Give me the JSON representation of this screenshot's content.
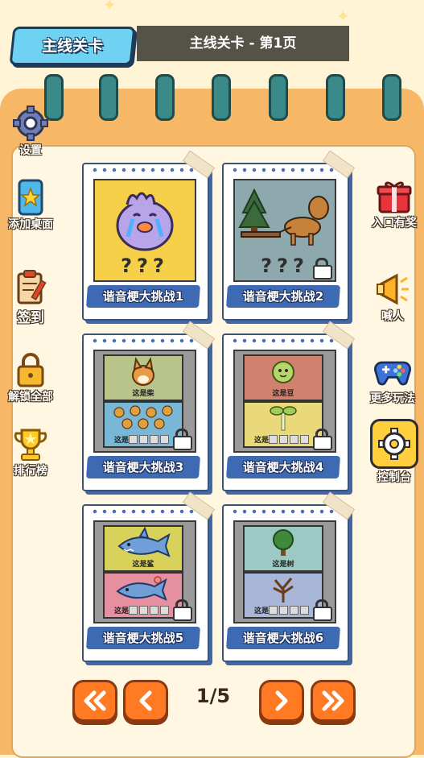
{
  "header": {
    "title": "主线关卡",
    "subtitle": "主线关卡 - 第1页"
  },
  "left_menu": [
    {
      "label": "设置",
      "icon": "gear-icon"
    },
    {
      "label": "添加桌面",
      "icon": "star-phone-icon"
    },
    {
      "label": "签到",
      "icon": "clipboard-pencil-icon"
    },
    {
      "label": "解锁全部",
      "icon": "padlock-icon"
    },
    {
      "label": "排行榜",
      "icon": "trophy-icon"
    }
  ],
  "right_menu": [
    {
      "label": "入口有奖",
      "icon": "gift-icon"
    },
    {
      "label": "喊人",
      "icon": "megaphone-icon"
    },
    {
      "label": "更多玩法",
      "icon": "gamepad-icon"
    },
    {
      "label": "控制台",
      "icon": "gear-icon"
    }
  ],
  "levels": [
    {
      "label": "谐音梗大挑战1",
      "locked": false,
      "hint": "???",
      "icon": "crying-bird-icon"
    },
    {
      "label": "谐音梗大挑战2",
      "locked": true,
      "hint": "???",
      "icon": "horse-sled-icon"
    },
    {
      "label": "谐音梗大挑战3",
      "locked": true,
      "top_caption": "这是柴",
      "bottom_caption": "这是",
      "icon": "shiba-dog-icon"
    },
    {
      "label": "谐音梗大挑战4",
      "locked": true,
      "top_caption": "这是豆",
      "bottom_caption": "这是",
      "icon": "pea-icon"
    },
    {
      "label": "谐音梗大挑战5",
      "locked": true,
      "top_caption": "这是鲨",
      "bottom_caption": "这是",
      "icon": "shark-icon"
    },
    {
      "label": "谐音梗大挑战6",
      "locked": true,
      "top_caption": "这是树",
      "bottom_caption": "这是",
      "icon": "tree-icon"
    }
  ],
  "pager": {
    "current": "1/5",
    "first_icon": "double-chevron-left-icon",
    "prev_icon": "chevron-left-icon",
    "next_icon": "chevron-right-icon",
    "last_icon": "double-chevron-right-icon"
  },
  "colors": {
    "accent_orange": "#ff7a23",
    "card_blue": "#3e6ab4",
    "header_cyan": "#6fd2f2"
  }
}
